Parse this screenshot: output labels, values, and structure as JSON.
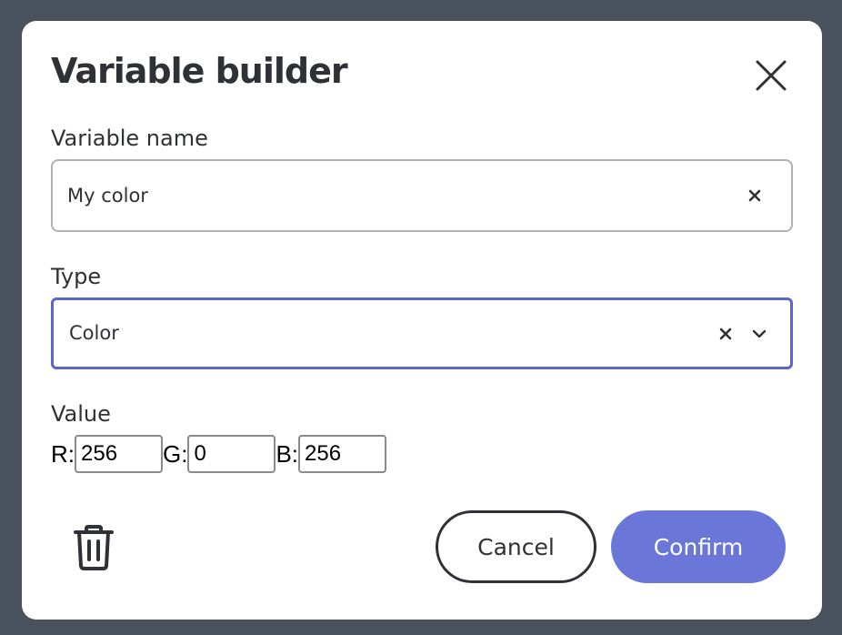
{
  "dialog": {
    "title": "Variable builder"
  },
  "name_field": {
    "label": "Variable name",
    "value": "My color"
  },
  "type_field": {
    "label": "Type",
    "value": "Color"
  },
  "value_field": {
    "label": "Value",
    "r_label": "R:",
    "r_value": "256",
    "g_label": "G:",
    "g_value": "0",
    "b_label": "B:",
    "b_value": "256"
  },
  "actions": {
    "cancel_label": "Cancel",
    "confirm_label": "Confirm"
  },
  "icons": {
    "close": "close-icon",
    "clear": "clear-icon",
    "chevron": "chevron-down-icon",
    "delete": "trash-icon"
  },
  "colors": {
    "accent": "#6b76d9",
    "focus_border": "#5b67c8",
    "text": "#2f3137",
    "backdrop": "#4a525d"
  }
}
